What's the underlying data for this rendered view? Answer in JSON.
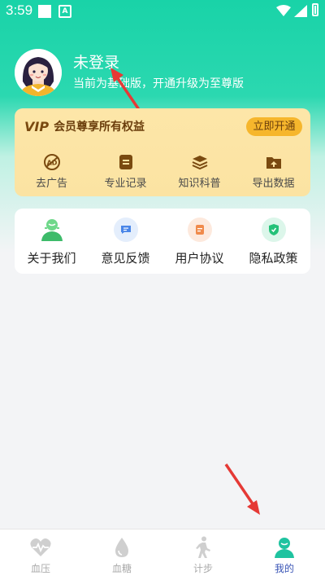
{
  "status_bar": {
    "time": "3:59",
    "notification_letter": "A"
  },
  "profile": {
    "name": "未登录",
    "subtitle": "当前为基础版，开通升级为至尊版"
  },
  "vip": {
    "badge": "VIP",
    "title": "会员尊享所有权益",
    "open_label": "立即开通",
    "items": [
      {
        "label": "去广告",
        "icon": "no-ads-icon"
      },
      {
        "label": "专业记录",
        "icon": "record-icon"
      },
      {
        "label": "知识科普",
        "icon": "knowledge-icon"
      },
      {
        "label": "导出数据",
        "icon": "export-icon"
      }
    ]
  },
  "menu": {
    "items": [
      {
        "label": "关于我们",
        "icon": "about-icon"
      },
      {
        "label": "意见反馈",
        "icon": "feedback-icon"
      },
      {
        "label": "用户协议",
        "icon": "agreement-icon"
      },
      {
        "label": "隐私政策",
        "icon": "privacy-icon"
      }
    ]
  },
  "nav": {
    "tabs": [
      {
        "label": "血压",
        "icon": "heart-pulse-icon"
      },
      {
        "label": "血糖",
        "icon": "drop-icon"
      },
      {
        "label": "计步",
        "icon": "walking-icon"
      },
      {
        "label": "我的",
        "icon": "profile-icon",
        "active": true
      }
    ]
  },
  "colors": {
    "accent": "#1fd3a8",
    "gold": "#f6b62c",
    "nav_active": "#3b56b6"
  }
}
